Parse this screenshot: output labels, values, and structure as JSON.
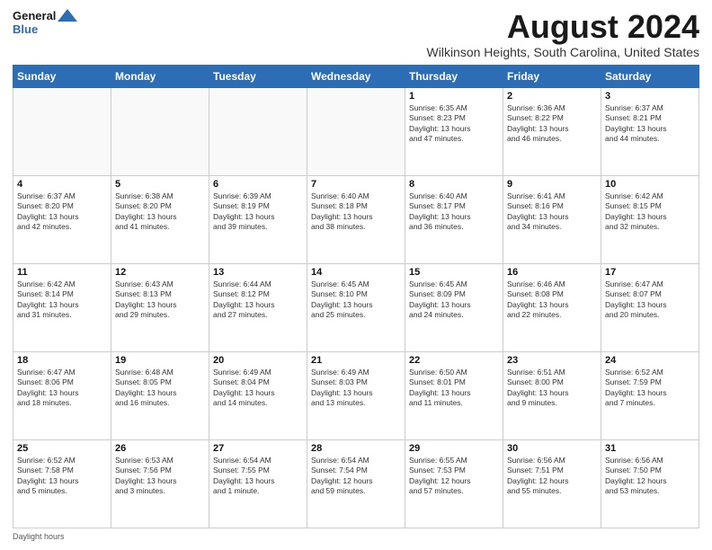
{
  "header": {
    "logo_line1": "General",
    "logo_line2": "Blue",
    "month_title": "August 2024",
    "location": "Wilkinson Heights, South Carolina, United States"
  },
  "days_of_week": [
    "Sunday",
    "Monday",
    "Tuesday",
    "Wednesday",
    "Thursday",
    "Friday",
    "Saturday"
  ],
  "weeks": [
    [
      {
        "day": "",
        "info": ""
      },
      {
        "day": "",
        "info": ""
      },
      {
        "day": "",
        "info": ""
      },
      {
        "day": "",
        "info": ""
      },
      {
        "day": "1",
        "info": "Sunrise: 6:35 AM\nSunset: 8:23 PM\nDaylight: 13 hours\nand 47 minutes."
      },
      {
        "day": "2",
        "info": "Sunrise: 6:36 AM\nSunset: 8:22 PM\nDaylight: 13 hours\nand 46 minutes."
      },
      {
        "day": "3",
        "info": "Sunrise: 6:37 AM\nSunset: 8:21 PM\nDaylight: 13 hours\nand 44 minutes."
      }
    ],
    [
      {
        "day": "4",
        "info": "Sunrise: 6:37 AM\nSunset: 8:20 PM\nDaylight: 13 hours\nand 42 minutes."
      },
      {
        "day": "5",
        "info": "Sunrise: 6:38 AM\nSunset: 8:20 PM\nDaylight: 13 hours\nand 41 minutes."
      },
      {
        "day": "6",
        "info": "Sunrise: 6:39 AM\nSunset: 8:19 PM\nDaylight: 13 hours\nand 39 minutes."
      },
      {
        "day": "7",
        "info": "Sunrise: 6:40 AM\nSunset: 8:18 PM\nDaylight: 13 hours\nand 38 minutes."
      },
      {
        "day": "8",
        "info": "Sunrise: 6:40 AM\nSunset: 8:17 PM\nDaylight: 13 hours\nand 36 minutes."
      },
      {
        "day": "9",
        "info": "Sunrise: 6:41 AM\nSunset: 8:16 PM\nDaylight: 13 hours\nand 34 minutes."
      },
      {
        "day": "10",
        "info": "Sunrise: 6:42 AM\nSunset: 8:15 PM\nDaylight: 13 hours\nand 32 minutes."
      }
    ],
    [
      {
        "day": "11",
        "info": "Sunrise: 6:42 AM\nSunset: 8:14 PM\nDaylight: 13 hours\nand 31 minutes."
      },
      {
        "day": "12",
        "info": "Sunrise: 6:43 AM\nSunset: 8:13 PM\nDaylight: 13 hours\nand 29 minutes."
      },
      {
        "day": "13",
        "info": "Sunrise: 6:44 AM\nSunset: 8:12 PM\nDaylight: 13 hours\nand 27 minutes."
      },
      {
        "day": "14",
        "info": "Sunrise: 6:45 AM\nSunset: 8:10 PM\nDaylight: 13 hours\nand 25 minutes."
      },
      {
        "day": "15",
        "info": "Sunrise: 6:45 AM\nSunset: 8:09 PM\nDaylight: 13 hours\nand 24 minutes."
      },
      {
        "day": "16",
        "info": "Sunrise: 6:46 AM\nSunset: 8:08 PM\nDaylight: 13 hours\nand 22 minutes."
      },
      {
        "day": "17",
        "info": "Sunrise: 6:47 AM\nSunset: 8:07 PM\nDaylight: 13 hours\nand 20 minutes."
      }
    ],
    [
      {
        "day": "18",
        "info": "Sunrise: 6:47 AM\nSunset: 8:06 PM\nDaylight: 13 hours\nand 18 minutes."
      },
      {
        "day": "19",
        "info": "Sunrise: 6:48 AM\nSunset: 8:05 PM\nDaylight: 13 hours\nand 16 minutes."
      },
      {
        "day": "20",
        "info": "Sunrise: 6:49 AM\nSunset: 8:04 PM\nDaylight: 13 hours\nand 14 minutes."
      },
      {
        "day": "21",
        "info": "Sunrise: 6:49 AM\nSunset: 8:03 PM\nDaylight: 13 hours\nand 13 minutes."
      },
      {
        "day": "22",
        "info": "Sunrise: 6:50 AM\nSunset: 8:01 PM\nDaylight: 13 hours\nand 11 minutes."
      },
      {
        "day": "23",
        "info": "Sunrise: 6:51 AM\nSunset: 8:00 PM\nDaylight: 13 hours\nand 9 minutes."
      },
      {
        "day": "24",
        "info": "Sunrise: 6:52 AM\nSunset: 7:59 PM\nDaylight: 13 hours\nand 7 minutes."
      }
    ],
    [
      {
        "day": "25",
        "info": "Sunrise: 6:52 AM\nSunset: 7:58 PM\nDaylight: 13 hours\nand 5 minutes."
      },
      {
        "day": "26",
        "info": "Sunrise: 6:53 AM\nSunset: 7:56 PM\nDaylight: 13 hours\nand 3 minutes."
      },
      {
        "day": "27",
        "info": "Sunrise: 6:54 AM\nSunset: 7:55 PM\nDaylight: 13 hours\nand 1 minute."
      },
      {
        "day": "28",
        "info": "Sunrise: 6:54 AM\nSunset: 7:54 PM\nDaylight: 12 hours\nand 59 minutes."
      },
      {
        "day": "29",
        "info": "Sunrise: 6:55 AM\nSunset: 7:53 PM\nDaylight: 12 hours\nand 57 minutes."
      },
      {
        "day": "30",
        "info": "Sunrise: 6:56 AM\nSunset: 7:51 PM\nDaylight: 12 hours\nand 55 minutes."
      },
      {
        "day": "31",
        "info": "Sunrise: 6:56 AM\nSunset: 7:50 PM\nDaylight: 12 hours\nand 53 minutes."
      }
    ]
  ],
  "footer": {
    "daylight_label": "Daylight hours"
  }
}
